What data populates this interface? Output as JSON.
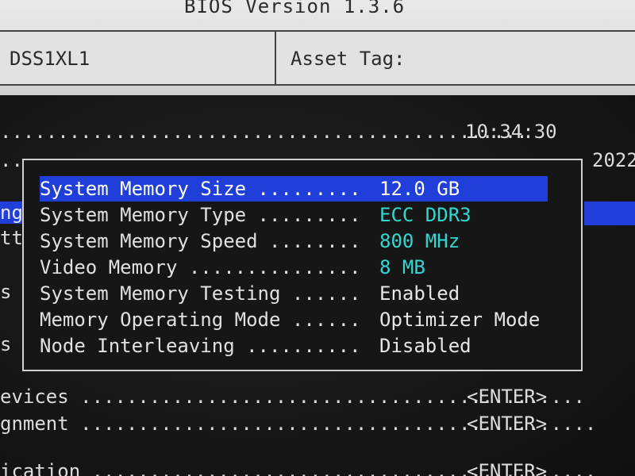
{
  "header": {
    "bios_version": "BIOS Version 1.3.6",
    "service_tag": "DSS1XL1",
    "asset_tag_label": "Asset Tag:"
  },
  "main": {
    "time": "10:34:30",
    "time_leader": "..............................................",
    "date_fragment": "2022",
    "dots_fragment": "..",
    "left_fragments": [
      "ng",
      "tt",
      "s",
      "s"
    ]
  },
  "memory_settings": {
    "items": [
      {
        "label": "System Memory Size .........",
        "value": "12.0 GB",
        "selected": true
      },
      {
        "label": "System Memory Type .........",
        "value": "ECC DDR3"
      },
      {
        "label": "System Memory Speed ........",
        "value": "800 MHz"
      },
      {
        "label": "Video Memory ...............",
        "value": "8 MB"
      },
      {
        "label": "System Memory Testing ......",
        "value": "Enabled"
      },
      {
        "label": "Memory Operating Mode ......",
        "value": "Optimizer Mode"
      },
      {
        "label": "Node Interleaving ..........",
        "value": "Disabled"
      }
    ]
  },
  "menu": {
    "items": [
      {
        "label": "evices ............................................",
        "action": "<ENTER>"
      },
      {
        "label": "gnment .............................................",
        "action": "<ENTER>"
      },
      {
        "label": "ication ............................................",
        "action": "<ENTER>"
      }
    ]
  },
  "colors": {
    "highlight": "#1f3fd8",
    "value_cyan": "#33d6d0",
    "screen_bg": "#161616"
  }
}
